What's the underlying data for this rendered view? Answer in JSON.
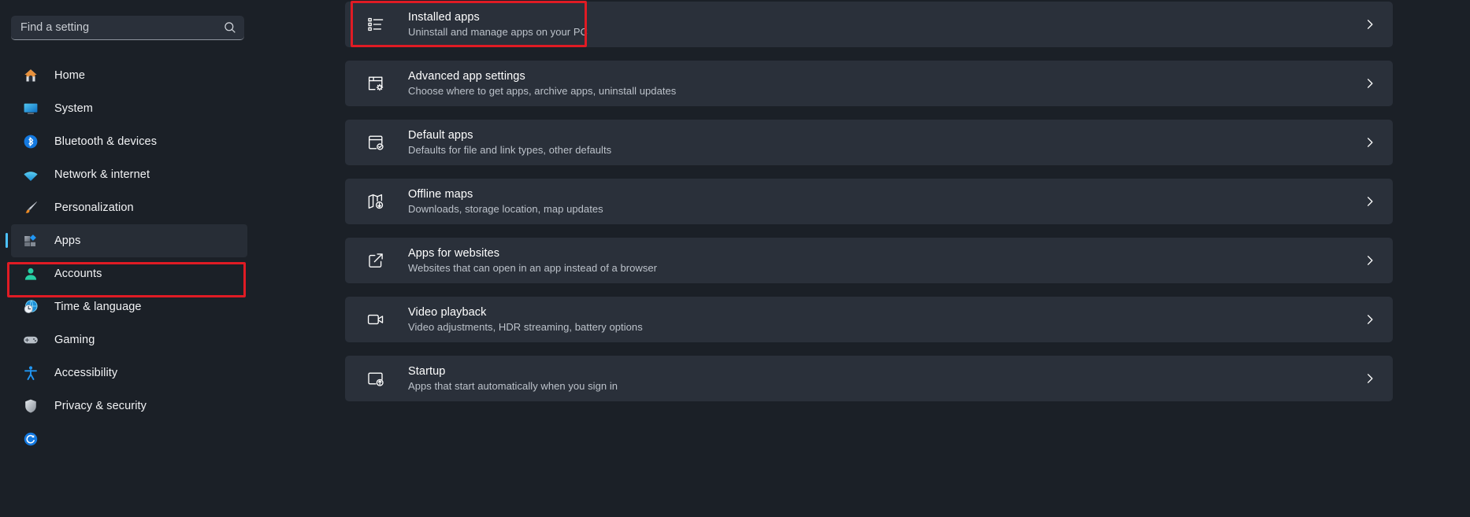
{
  "accent_color": "#4cc2ff",
  "annotation_color": "#e01b24",
  "background_color": "#1b2027",
  "card_color": "#2a303a",
  "search": {
    "placeholder": "Find a setting",
    "value": "",
    "icon": "search-icon"
  },
  "sidebar": {
    "items": [
      {
        "label": "Home",
        "icon": "home-icon",
        "selected": false
      },
      {
        "label": "System",
        "icon": "system-icon",
        "selected": false
      },
      {
        "label": "Bluetooth & devices",
        "icon": "bluetooth-icon",
        "selected": false
      },
      {
        "label": "Network & internet",
        "icon": "wifi-icon",
        "selected": false
      },
      {
        "label": "Personalization",
        "icon": "paintbrush-icon",
        "selected": false
      },
      {
        "label": "Apps",
        "icon": "apps-icon",
        "selected": true
      },
      {
        "label": "Accounts",
        "icon": "person-icon",
        "selected": false
      },
      {
        "label": "Time & language",
        "icon": "clock-globe-icon",
        "selected": false
      },
      {
        "label": "Gaming",
        "icon": "gamepad-icon",
        "selected": false
      },
      {
        "label": "Accessibility",
        "icon": "accessibility-icon",
        "selected": false
      },
      {
        "label": "Privacy & security",
        "icon": "shield-icon",
        "selected": false
      },
      {
        "label": "",
        "icon": "windows-update-icon",
        "selected": false
      }
    ]
  },
  "main": {
    "cards": [
      {
        "title": "Installed apps",
        "subtitle": "Uninstall and manage apps on your PC",
        "icon": "bulleted-list-icon",
        "chevron": "chevron-right-icon",
        "highlighted": true
      },
      {
        "title": "Advanced app settings",
        "subtitle": "Choose where to get apps, archive apps, uninstall updates",
        "icon": "app-settings-icon",
        "chevron": "chevron-right-icon",
        "highlighted": false
      },
      {
        "title": "Default apps",
        "subtitle": "Defaults for file and link types, other defaults",
        "icon": "default-apps-icon",
        "chevron": "chevron-right-icon",
        "highlighted": false
      },
      {
        "title": "Offline maps",
        "subtitle": "Downloads, storage location, map updates",
        "icon": "map-download-icon",
        "chevron": "chevron-right-icon",
        "highlighted": false
      },
      {
        "title": "Apps for websites",
        "subtitle": "Websites that can open in an app instead of a browser",
        "icon": "open-external-icon",
        "chevron": "chevron-right-icon",
        "highlighted": false
      },
      {
        "title": "Video playback",
        "subtitle": "Video adjustments, HDR streaming, battery options",
        "icon": "video-camera-icon",
        "chevron": "chevron-right-icon",
        "highlighted": false
      },
      {
        "title": "Startup",
        "subtitle": "Apps that start automatically when you sign in",
        "icon": "startup-icon",
        "chevron": "chevron-right-icon",
        "highlighted": false
      }
    ]
  }
}
